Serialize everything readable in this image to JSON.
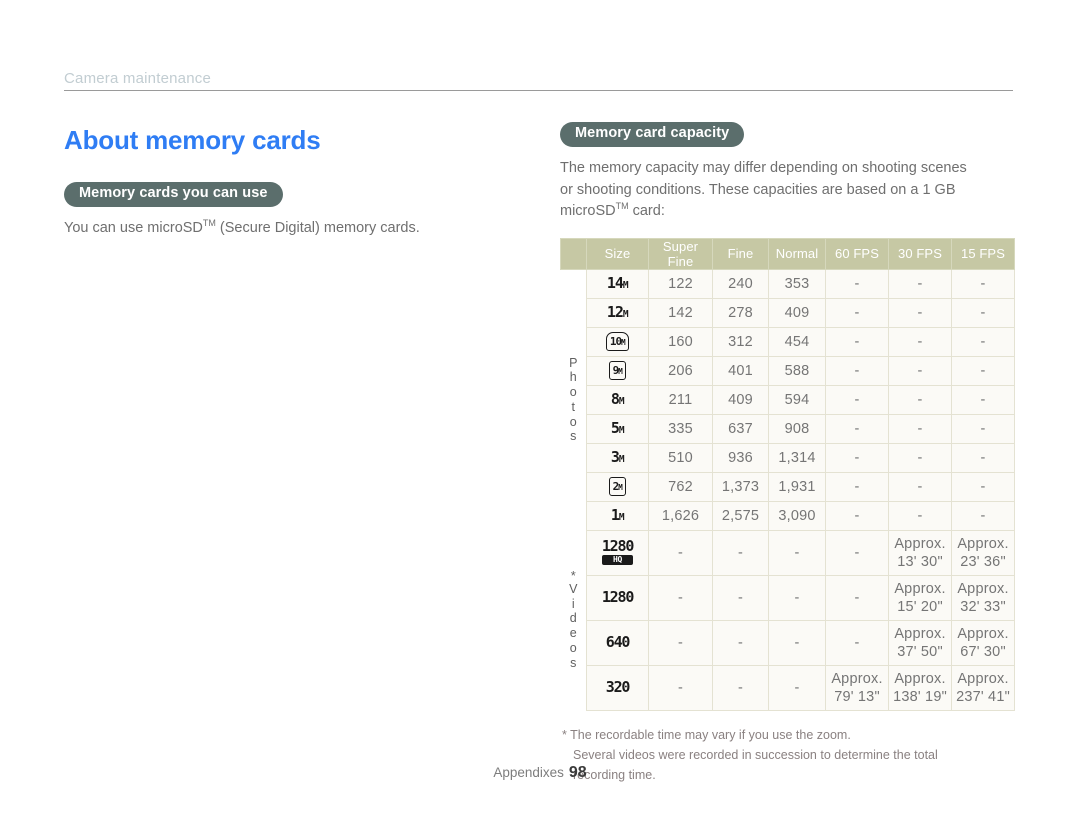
{
  "running_head": {
    "label": "Camera maintenance"
  },
  "left_column": {
    "title": "About memory cards",
    "section_badge": "Memory cards you can use",
    "body_prefix": "You can use microSD",
    "body_sup": "TM",
    "body_suffix": " (Secure Digital) memory cards."
  },
  "right_column": {
    "section_badge": "Memory card capacity",
    "intro_line1": "The memory capacity may differ depending on shooting scenes",
    "intro_line2": "or shooting conditions. These capacities are based on a 1 GB",
    "intro_line3_prefix": "microSD",
    "intro_line3_sup": "TM",
    "intro_line3_suffix": " card:"
  },
  "table": {
    "headers": [
      "Size",
      "Super Fine",
      "Fine",
      "Normal",
      "60 FPS",
      "30 FPS",
      "15 FPS"
    ],
    "group_photos": "Photos",
    "group_videos": "Videos",
    "group_videos_star": "*",
    "photo_rows": [
      {
        "size_value": "14",
        "size_unit": "M",
        "size_style": "plain",
        "cells": [
          "122",
          "240",
          "353",
          "-",
          "-",
          "-"
        ]
      },
      {
        "size_value": "12",
        "size_unit": "M",
        "size_style": "plain",
        "cells": [
          "142",
          "278",
          "409",
          "-",
          "-",
          "-"
        ]
      },
      {
        "size_value": "10",
        "size_unit": "M",
        "size_style": "framed-round",
        "cells": [
          "160",
          "312",
          "454",
          "-",
          "-",
          "-"
        ]
      },
      {
        "size_value": "9",
        "size_unit": "M",
        "size_style": "framed",
        "cells": [
          "206",
          "401",
          "588",
          "-",
          "-",
          "-"
        ]
      },
      {
        "size_value": "8",
        "size_unit": "M",
        "size_style": "plain",
        "cells": [
          "211",
          "409",
          "594",
          "-",
          "-",
          "-"
        ]
      },
      {
        "size_value": "5",
        "size_unit": "M",
        "size_style": "plain",
        "cells": [
          "335",
          "637",
          "908",
          "-",
          "-",
          "-"
        ]
      },
      {
        "size_value": "3",
        "size_unit": "M",
        "size_style": "plain",
        "cells": [
          "510",
          "936",
          "1,314",
          "-",
          "-",
          "-"
        ]
      },
      {
        "size_value": "2",
        "size_unit": "M",
        "size_style": "framed",
        "cells": [
          "762",
          "1,373",
          "1,931",
          "-",
          "-",
          "-"
        ]
      },
      {
        "size_value": "1",
        "size_unit": "M",
        "size_style": "plain",
        "cells": [
          "1,626",
          "2,575",
          "3,090",
          "-",
          "-",
          "-"
        ]
      }
    ],
    "video_rows": [
      {
        "size_value": "1280",
        "size_badge": "HQ",
        "size_style": "video-hq",
        "cells": [
          "-",
          "-",
          "-",
          "-",
          "Approx.\n13' 30\"",
          "Approx.\n23' 36\""
        ]
      },
      {
        "size_value": "1280",
        "size_badge": "",
        "size_style": "video",
        "cells": [
          "-",
          "-",
          "-",
          "-",
          "Approx.\n15' 20\"",
          "Approx.\n32' 33\""
        ]
      },
      {
        "size_value": "640",
        "size_badge": "",
        "size_style": "video",
        "cells": [
          "-",
          "-",
          "-",
          "-",
          "Approx.\n37' 50\"",
          "Approx.\n67' 30\""
        ]
      },
      {
        "size_value": "320",
        "size_badge": "",
        "size_style": "video",
        "cells": [
          "-",
          "-",
          "-",
          "Approx.\n79' 13\"",
          "Approx.\n138' 19\"",
          "Approx.\n237' 41\""
        ]
      }
    ]
  },
  "footnote": {
    "star": "*",
    "line1": "The recordable time may vary if you use the zoom.",
    "line2": "Several videos were recorded in succession to determine the total",
    "line3": "recording time."
  },
  "page_footer": {
    "label": "Appendixes",
    "number": "98"
  },
  "colors": {
    "title_blue": "#2f7df4",
    "pill_bg": "#5b6e6c",
    "table_header_bg": "#c6c8a4",
    "table_cell_bg": "#fbfaf6",
    "running_head": "#c2cdd2"
  }
}
